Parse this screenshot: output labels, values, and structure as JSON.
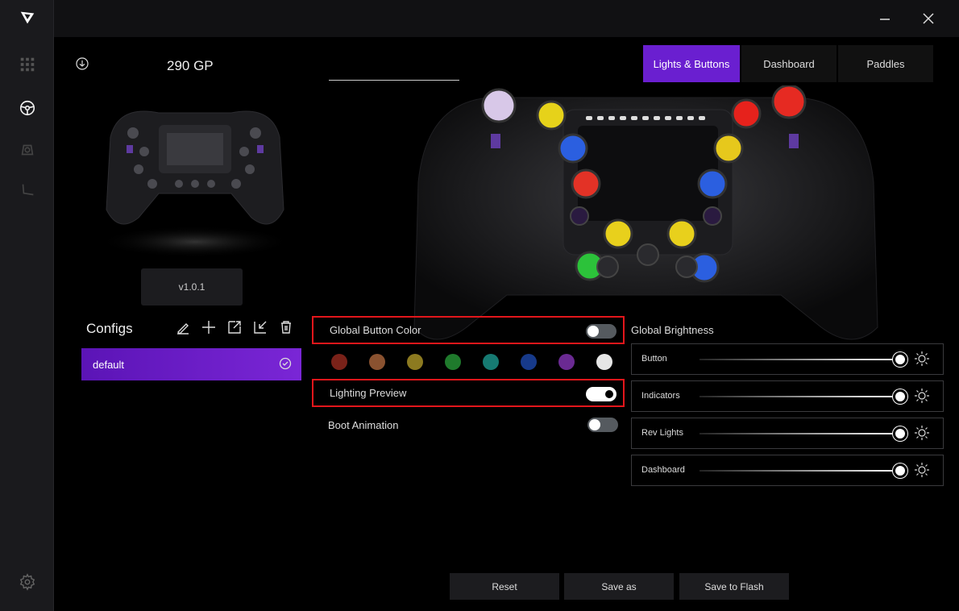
{
  "rail": {
    "icons": [
      "logo-icon",
      "apps-grid-icon",
      "steering-wheel-icon",
      "pedals-icon",
      "seat-icon",
      "settings-gear-icon"
    ]
  },
  "window": {
    "minimize_icon": "minimize-icon",
    "close_icon": "close-icon"
  },
  "device": {
    "name": "290 GP",
    "version": "v1.0.1"
  },
  "configs": {
    "label": "Configs",
    "tools": [
      "edit-icon",
      "add-icon",
      "export-icon",
      "import-icon",
      "delete-icon"
    ],
    "items": [
      {
        "label": "default",
        "selected": true
      }
    ]
  },
  "tabs": [
    {
      "label": "Lights & Buttons",
      "active": true
    },
    {
      "label": "Dashboard",
      "active": false
    },
    {
      "label": "Paddles",
      "active": false
    }
  ],
  "settings": {
    "global_button_color": {
      "label": "Global Button Color",
      "enabled": false
    },
    "swatches": [
      "#7a2219",
      "#8a5230",
      "#8c7a20",
      "#1f7a2c",
      "#167a72",
      "#173a8a",
      "#6a2a92",
      "#e6e6e6"
    ],
    "lighting_preview": {
      "label": "Lighting Preview",
      "enabled": true
    },
    "boot_animation": {
      "label": "Boot Animation",
      "enabled": false
    }
  },
  "brightness": {
    "label": "Global Brightness",
    "rows": [
      {
        "label": "Button",
        "level": 1.0
      },
      {
        "label": "Indicators",
        "level": 1.0
      },
      {
        "label": "Rev Lights",
        "level": 1.0
      },
      {
        "label": "Dashboard",
        "level": 1.0
      }
    ]
  },
  "actions": {
    "reset": "Reset",
    "save_as": "Save as",
    "save_to_flash": "Save to Flash"
  },
  "colors": {
    "accent": "#6a1fd0",
    "highlight_border": "#e3161b"
  }
}
